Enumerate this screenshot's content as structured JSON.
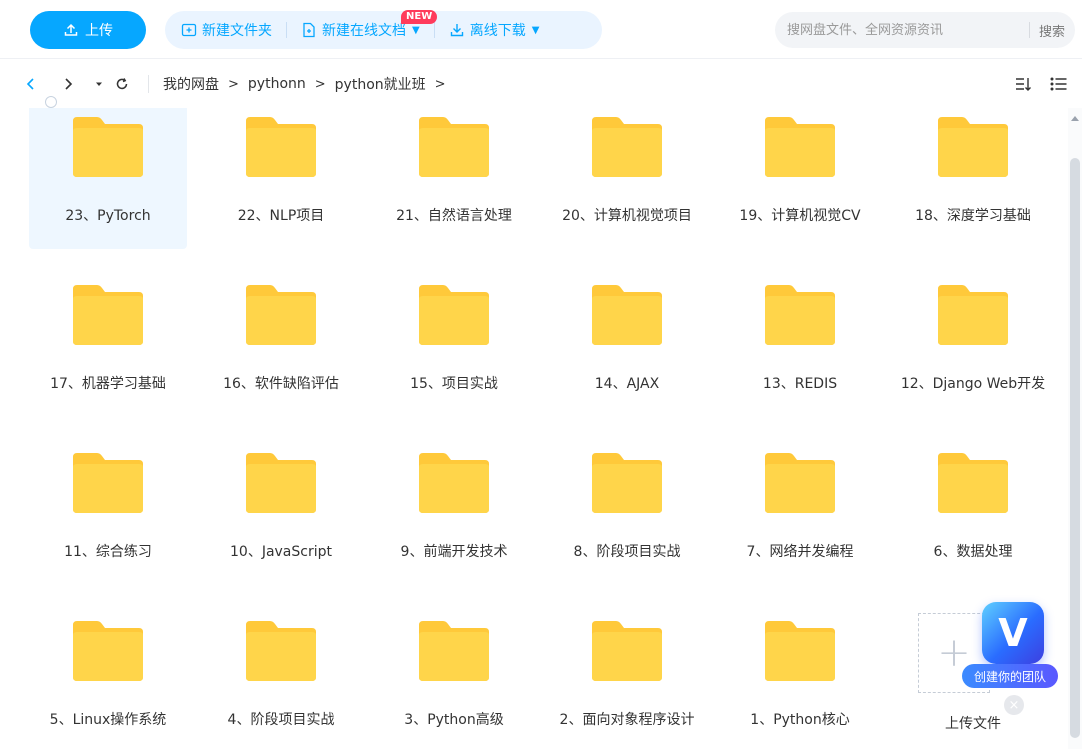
{
  "toolbar": {
    "upload_label": "上传",
    "new_folder_label": "新建文件夹",
    "new_online_doc_label": "新建在线文档",
    "new_badge": "NEW",
    "offline_download_label": "离线下载",
    "search_placeholder": "搜网盘文件、全网资源资讯",
    "search_button": "搜索"
  },
  "breadcrumb": [
    "我的网盘",
    "pythonn",
    "python就业班"
  ],
  "breadcrumb_sep": ">",
  "folders": [
    "23、PyTorch",
    "22、NLP项目",
    "21、自然语言处理",
    "20、计算机视觉项目",
    "19、计算机视觉CV",
    "18、深度学习基础",
    "17、机器学习基础",
    "16、软件缺陷评估",
    "15、项目实战",
    "14、AJAX",
    "13、REDIS",
    "12、Django Web开发",
    "11、综合练习",
    "10、JavaScript",
    "9、前端开发技术",
    "8、阶段项目实战",
    "7、网络并发编程",
    "6、数据处理",
    "5、Linux操作系统",
    "4、阶段项目实战",
    "3、Python高级",
    "2、面向对象程序设计",
    "1、Python核心"
  ],
  "upload_tile_label": "上传文件",
  "promo": {
    "logo_letter": "V",
    "label": "创建你的团队"
  },
  "colors": {
    "accent": "#06a7ff",
    "folder": "#ffd54a",
    "folder_tab": "#ffc93a"
  }
}
